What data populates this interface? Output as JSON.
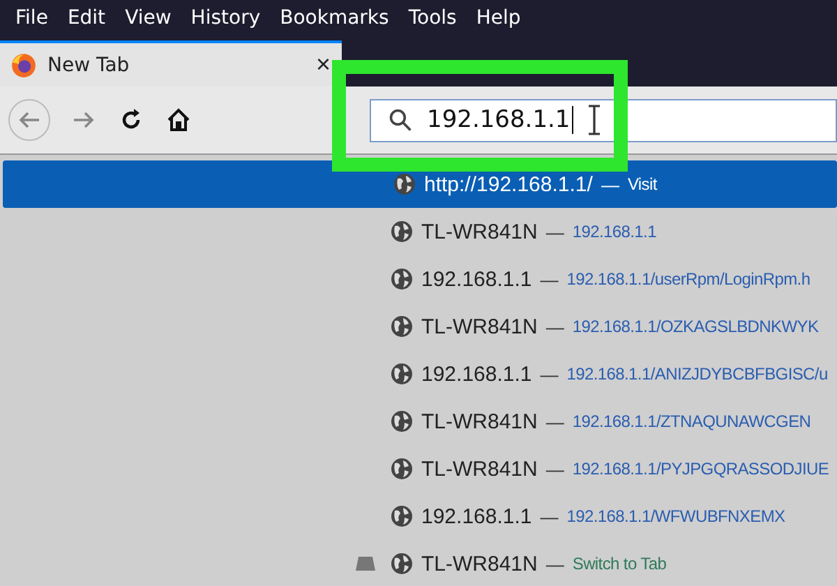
{
  "menu_bar": [
    "File",
    "Edit",
    "View",
    "History",
    "Bookmarks",
    "Tools",
    "Help"
  ],
  "tab": {
    "title": "New Tab",
    "close": "×"
  },
  "address_bar": {
    "value": "192.168.1.1"
  },
  "suggestions": [
    {
      "kind": "visit",
      "title": "http://192.168.1.1/",
      "dash": "—",
      "detail": "Visit",
      "selected": true
    },
    {
      "kind": "history",
      "title": "TL-WR841N",
      "dash": "—",
      "detail": "192.168.1.1",
      "selected": false
    },
    {
      "kind": "history",
      "title": "192.168.1.1",
      "dash": "—",
      "detail": "192.168.1.1/userRpm/LoginRpm.h",
      "selected": false
    },
    {
      "kind": "history",
      "title": "TL-WR841N",
      "dash": "—",
      "detail": "192.168.1.1/OZKAGSLBDNKWYK",
      "selected": false
    },
    {
      "kind": "history",
      "title": "192.168.1.1",
      "dash": "—",
      "detail": "192.168.1.1/ANIZJDYBCBFBGISC/u",
      "selected": false
    },
    {
      "kind": "history",
      "title": "TL-WR841N",
      "dash": "—",
      "detail": "192.168.1.1/ZTNAQUNAWCGEN",
      "selected": false
    },
    {
      "kind": "history",
      "title": "TL-WR841N",
      "dash": "—",
      "detail": "192.168.1.1/PYJPGQRASSODJIUE",
      "selected": false
    },
    {
      "kind": "history",
      "title": "192.168.1.1",
      "dash": "—",
      "detail": "192.168.1.1/WFWUBFNXEMX",
      "selected": false
    },
    {
      "kind": "switch",
      "title": "TL-WR841N",
      "dash": "—",
      "detail": "Switch to Tab",
      "selected": false
    }
  ]
}
